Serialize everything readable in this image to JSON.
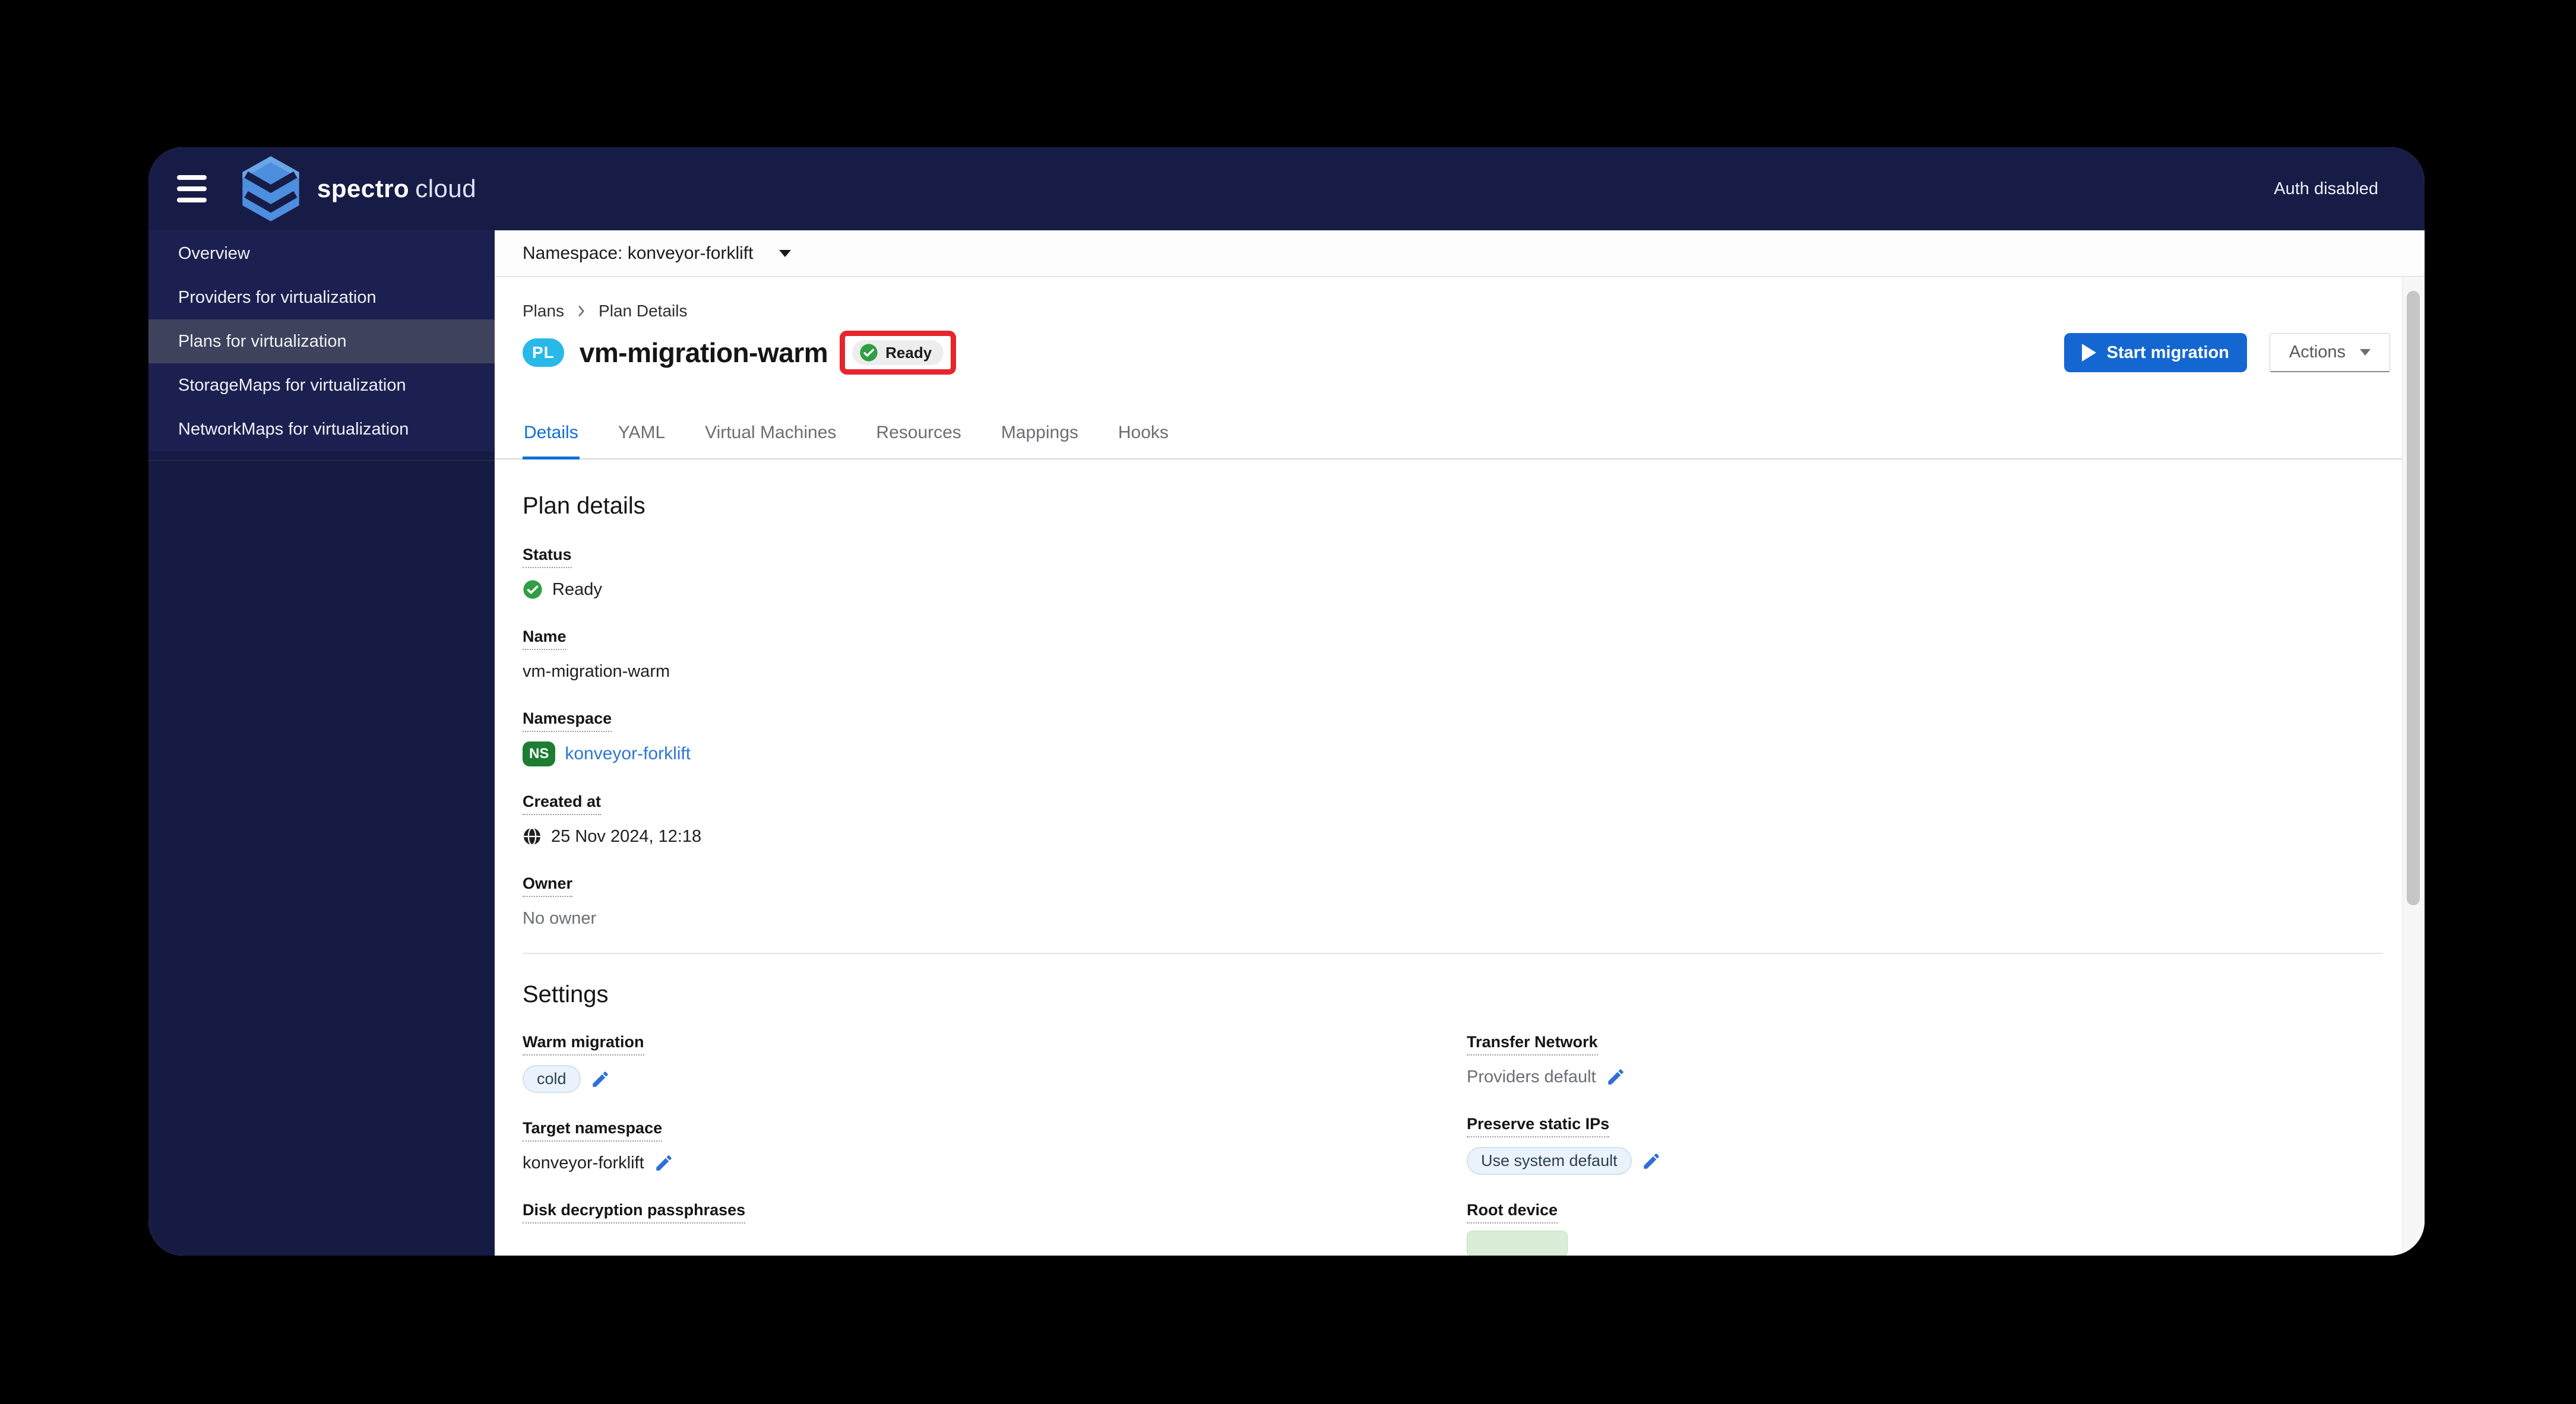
{
  "colors": {
    "navy": "#171c47",
    "accent_blue": "#1467d1",
    "link_blue": "#2e77d0",
    "active_tab_blue": "#0f6fd7",
    "status_green": "#2f9e44",
    "ns_badge_green": "#1e7d33",
    "pl_badge_cyan": "#29b9e8",
    "annotation_red": "#e6252c",
    "pill_blue_bg": "#eaf3fb",
    "muted_text": "#6a6e73"
  },
  "icons": {
    "menu": "hamburger-icon",
    "brand": "spectro-cloud-logo",
    "namespace_caret": "chevron-down-icon",
    "breadcrumb_separator": "chevron-right-icon",
    "status_ok": "check-circle-icon",
    "created": "globe-icon",
    "edit": "pencil-icon",
    "play": "play-icon"
  },
  "topbar": {
    "brand_bold": "spectro",
    "brand_light": "cloud",
    "auth_status": "Auth disabled"
  },
  "sidebar": {
    "items": [
      {
        "label": "Overview",
        "selected": false
      },
      {
        "label": "Providers for virtualization",
        "selected": false
      },
      {
        "label": "Plans for virtualization",
        "selected": true
      },
      {
        "label": "StorageMaps for virtualization",
        "selected": false
      },
      {
        "label": "NetworkMaps for virtualization",
        "selected": false
      }
    ]
  },
  "namespace_bar": {
    "label": "Namespace: konveyor-forklift"
  },
  "breadcrumb": {
    "items": [
      "Plans",
      "Plan Details"
    ]
  },
  "page_header": {
    "resource_badge": "PL",
    "title": "vm-migration-warm",
    "status_badge": "Ready",
    "start_button": "Start migration",
    "actions_button": "Actions"
  },
  "tabs": {
    "active": "Details",
    "items": [
      "Details",
      "YAML",
      "Virtual Machines",
      "Resources",
      "Mappings",
      "Hooks"
    ]
  },
  "plan_details": {
    "heading": "Plan details",
    "status": {
      "label": "Status",
      "value": "Ready"
    },
    "name": {
      "label": "Name",
      "value": "vm-migration-warm"
    },
    "namespace": {
      "label": "Namespace",
      "badge": "NS",
      "value": "konveyor-forklift"
    },
    "created_at": {
      "label": "Created at",
      "value": "25 Nov 2024, 12:18"
    },
    "owner": {
      "label": "Owner",
      "value": "No owner"
    }
  },
  "settings": {
    "heading": "Settings",
    "warm_migration": {
      "label": "Warm migration",
      "value": "cold"
    },
    "transfer_network": {
      "label": "Transfer Network",
      "value": "Providers default"
    },
    "target_namespace": {
      "label": "Target namespace",
      "value": "konveyor-forklift"
    },
    "preserve_static_ips": {
      "label": "Preserve static IPs",
      "value": "Use system default"
    },
    "disk_decryption_passphrases": {
      "label": "Disk decryption passphrases"
    },
    "root_device": {
      "label": "Root device"
    }
  }
}
